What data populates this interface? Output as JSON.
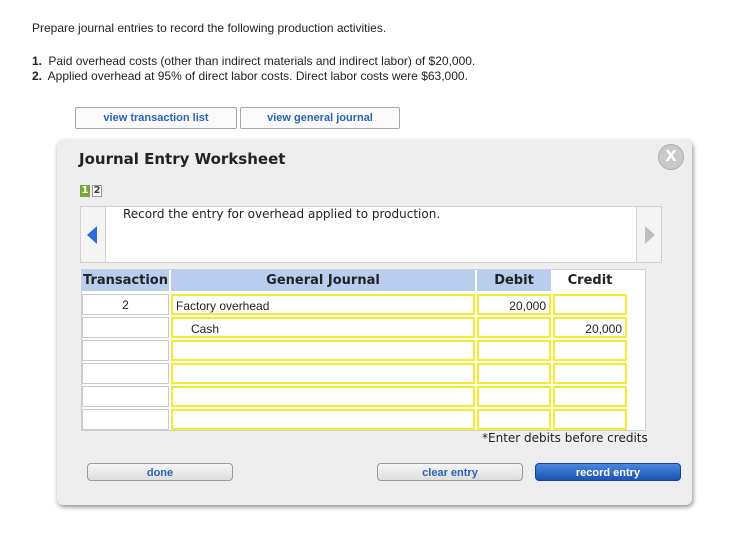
{
  "instructions": {
    "intro": "Prepare journal entries to record the following production activities.",
    "items": [
      {
        "num": "1.",
        "text": "Paid overhead costs (other than indirect materials and indirect labor) of $20,000."
      },
      {
        "num": "2.",
        "text": "Applied overhead at 95% of direct labor costs. Direct labor costs were $63,000."
      }
    ]
  },
  "top_buttons": {
    "transaction_list": "view transaction list",
    "general_journal": "view general journal"
  },
  "worksheet": {
    "title": "Journal Entry Worksheet",
    "close_glyph": "X",
    "steps": [
      "1",
      "2"
    ],
    "active_step": "1",
    "prompt": "Record the entry for overhead applied to production.",
    "columns": {
      "transaction": "Transaction",
      "general_journal": "General Journal",
      "debit": "Debit",
      "credit": "Credit"
    },
    "rows": [
      {
        "transaction": "2",
        "account": "Factory overhead",
        "debit": "20,000",
        "credit": ""
      },
      {
        "transaction": "",
        "account": "Cash",
        "debit": "",
        "credit": "20,000"
      },
      {
        "transaction": "",
        "account": "",
        "debit": "",
        "credit": ""
      },
      {
        "transaction": "",
        "account": "",
        "debit": "",
        "credit": ""
      },
      {
        "transaction": "",
        "account": "",
        "debit": "",
        "credit": ""
      },
      {
        "transaction": "",
        "account": "",
        "debit": "",
        "credit": ""
      }
    ],
    "note": "*Enter debits before credits",
    "buttons": {
      "done": "done",
      "clear": "clear entry",
      "record": "record entry"
    }
  },
  "colors": {
    "header_blue": "#b9cdee",
    "input_yellow": "#f5ec2c",
    "step_active_green": "#79a63b",
    "link_blue": "#2a63b8",
    "record_button_blue": "#1c55b5"
  },
  "icons": {
    "prev": "left-arrow-icon",
    "next": "right-arrow-icon",
    "close": "close-icon"
  }
}
